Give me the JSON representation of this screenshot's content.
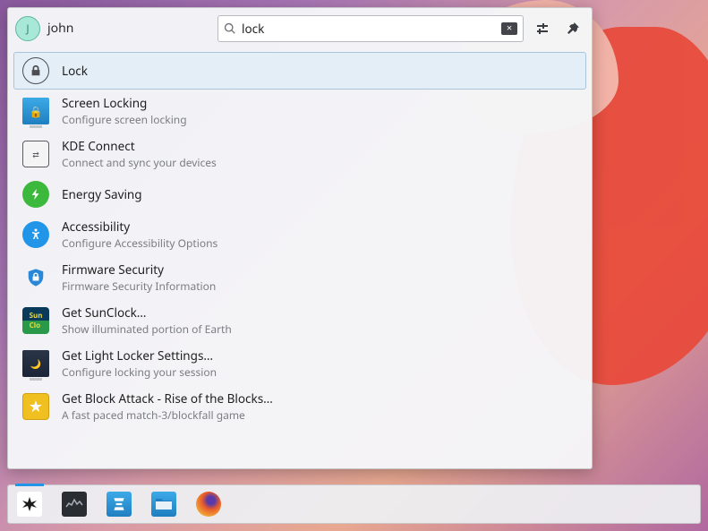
{
  "user": {
    "avatar_initial": "J",
    "name": "john"
  },
  "search": {
    "value": "lock"
  },
  "results": [
    {
      "title": "Lock",
      "subtitle": ""
    },
    {
      "title": "Screen Locking",
      "subtitle": "Configure screen locking"
    },
    {
      "title": "KDE Connect",
      "subtitle": "Connect and sync your devices"
    },
    {
      "title": "Energy Saving",
      "subtitle": ""
    },
    {
      "title": "Accessibility",
      "subtitle": "Configure Accessibility Options"
    },
    {
      "title": "Firmware Security",
      "subtitle": "Firmware Security Information"
    },
    {
      "title": "Get SunClock…",
      "subtitle": "Show illuminated portion of Earth"
    },
    {
      "title": "Get Light Locker Settings…",
      "subtitle": "Configure locking your session"
    },
    {
      "title": "Get Block Attack - Rise of the Blocks…",
      "subtitle": "A fast paced match-3/blockfall game"
    }
  ]
}
